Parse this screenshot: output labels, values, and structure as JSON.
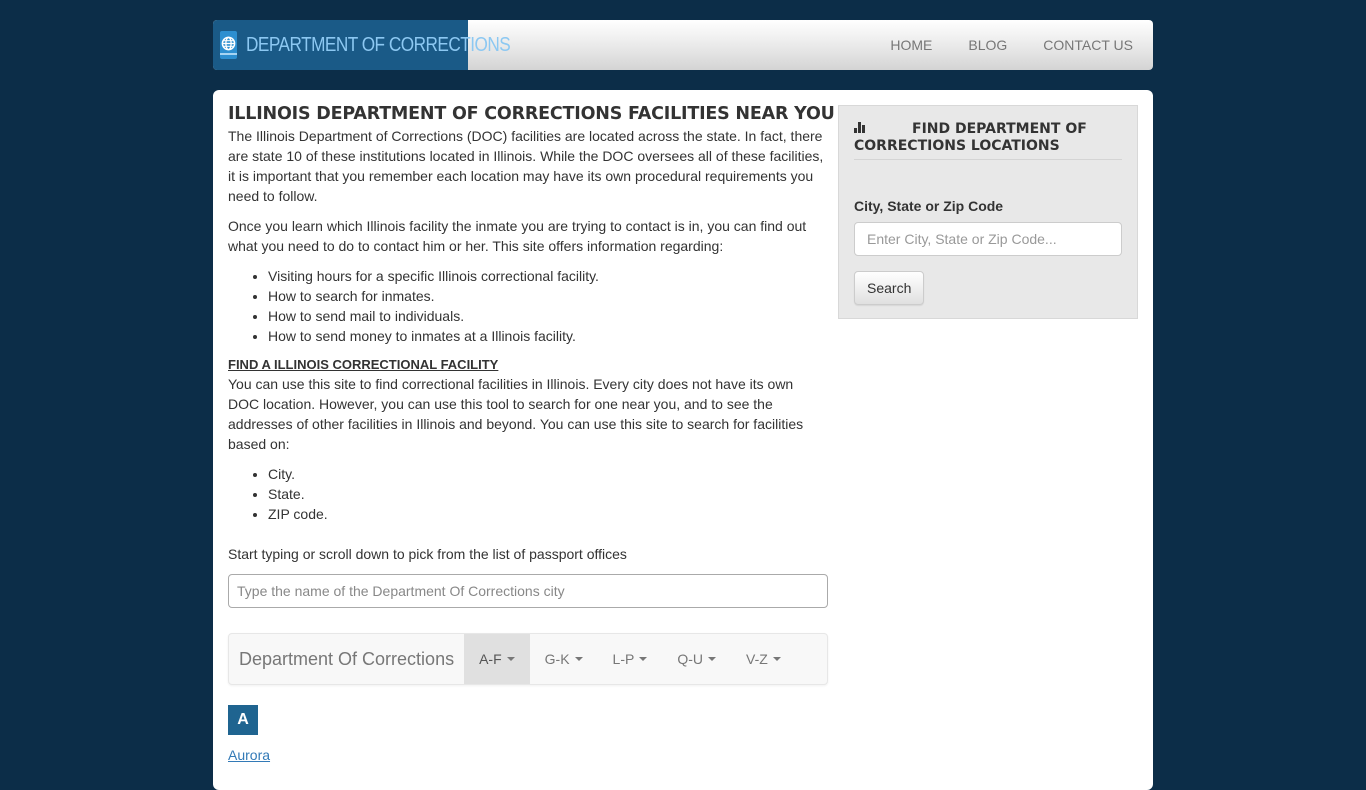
{
  "navbar": {
    "brand_icon": "passport-globe-icon",
    "brand_text": "DEPARTMENT OF CORRECTIONS",
    "links": [
      {
        "label": "HOME"
      },
      {
        "label": "BLOG"
      },
      {
        "label": "CONTACT US"
      }
    ]
  },
  "main": {
    "title": "ILLINOIS DEPARTMENT OF CORRECTIONS FACILITIES NEAR YOU",
    "intro": "The Illinois Department of Corrections (DOC) facilities are located across the state. In fact, there are state 10 of these institutions located in Illinois. While the DOC oversees all of these facilities, it is important that you remember each location may have its own procedural requirements you need to follow.",
    "para2": "Once you learn which Illinois facility the inmate you are trying to contact is in, you can find out what you need to do to contact him or her. This site offers information regarding:",
    "info_list": [
      "Visiting hours for a specific Illinois correctional facility.",
      "How to search for inmates.",
      "How to send mail to individuals.",
      "How to send money to inmates at a Illinois facility."
    ],
    "subheading": "FIND A ILLINOIS CORRECTIONAL FACILITY",
    "para3": "You can use this site to find correctional facilities in Illinois. Every city does not have its own DOC location. However, you can use this tool to search for one near you, and to see the addresses of other facilities in Illinois and beyond. You can use this site to search for facilities based on:",
    "search_list": [
      "City.",
      "State.",
      "ZIP code."
    ],
    "start_text": "Start typing or scroll down to pick from the list of passport offices",
    "city_input": {
      "value": "",
      "placeholder": "Type the name of the Department Of Corrections city"
    },
    "alpha_nav": {
      "title": "Department Of Corrections",
      "tabs": [
        {
          "label": "A-F",
          "active": true
        },
        {
          "label": "G-K",
          "active": false
        },
        {
          "label": "L-P",
          "active": false
        },
        {
          "label": "Q-U",
          "active": false
        },
        {
          "label": "V-Z",
          "active": false
        }
      ]
    },
    "letter": "A",
    "cities": [
      "Aurora"
    ]
  },
  "sidebar": {
    "icon": "bar-chart-icon",
    "title": "FIND DEPARTMENT OF CORRECTIONS LOCATIONS",
    "field_label": "City, State or Zip Code",
    "input": {
      "value": "",
      "placeholder": "Enter City, State or Zip Code..."
    },
    "button_label": "Search"
  },
  "colors": {
    "page_bg": "#0c2d48",
    "brand_bg": "#1a5a87",
    "brand_text": "#8cc8f2",
    "letter_badge": "#1f6490",
    "link": "#337ab7"
  }
}
